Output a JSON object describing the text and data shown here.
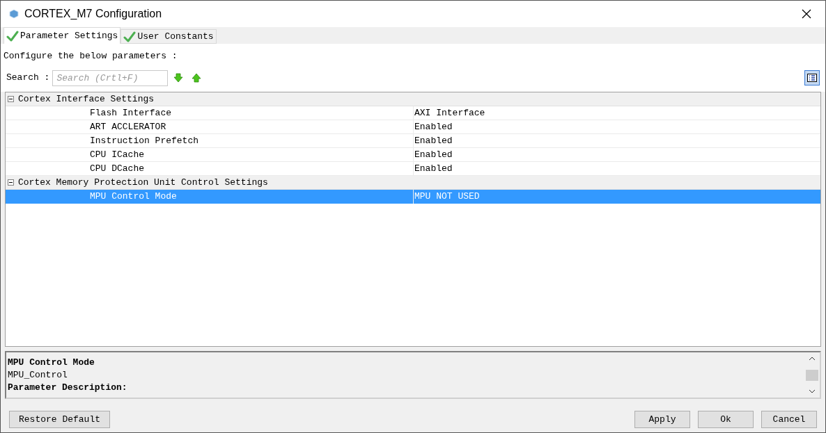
{
  "window": {
    "title": "CORTEX_M7 Configuration"
  },
  "tabs": [
    {
      "label": "Parameter Settings",
      "selected": true
    },
    {
      "label": "User Constants",
      "selected": false
    }
  ],
  "instruction": "Configure the below parameters :",
  "search": {
    "label": "Search :",
    "placeholder": "Search (Crtl+F)"
  },
  "groups": [
    {
      "title": "Cortex Interface Settings",
      "expanded": true,
      "rows": [
        {
          "name": "Flash Interface",
          "value": "AXI Interface",
          "selected": false
        },
        {
          "name": "ART ACCLERATOR",
          "value": "Enabled",
          "selected": false
        },
        {
          "name": "Instruction Prefetch",
          "value": "Enabled",
          "selected": false
        },
        {
          "name": "CPU ICache",
          "value": "Enabled",
          "selected": false
        },
        {
          "name": "CPU DCache",
          "value": "Enabled",
          "selected": false
        }
      ]
    },
    {
      "title": "Cortex Memory Protection Unit Control Settings",
      "expanded": true,
      "rows": [
        {
          "name": "MPU Control Mode",
          "value": "MPU NOT USED",
          "selected": true
        }
      ]
    }
  ],
  "description": {
    "title": "MPU Control Mode",
    "id": "MPU_Control",
    "heading": "Parameter Description:"
  },
  "buttons": {
    "restore": "Restore Default",
    "actions": [
      "Apply",
      "Ok",
      "Cancel"
    ]
  }
}
